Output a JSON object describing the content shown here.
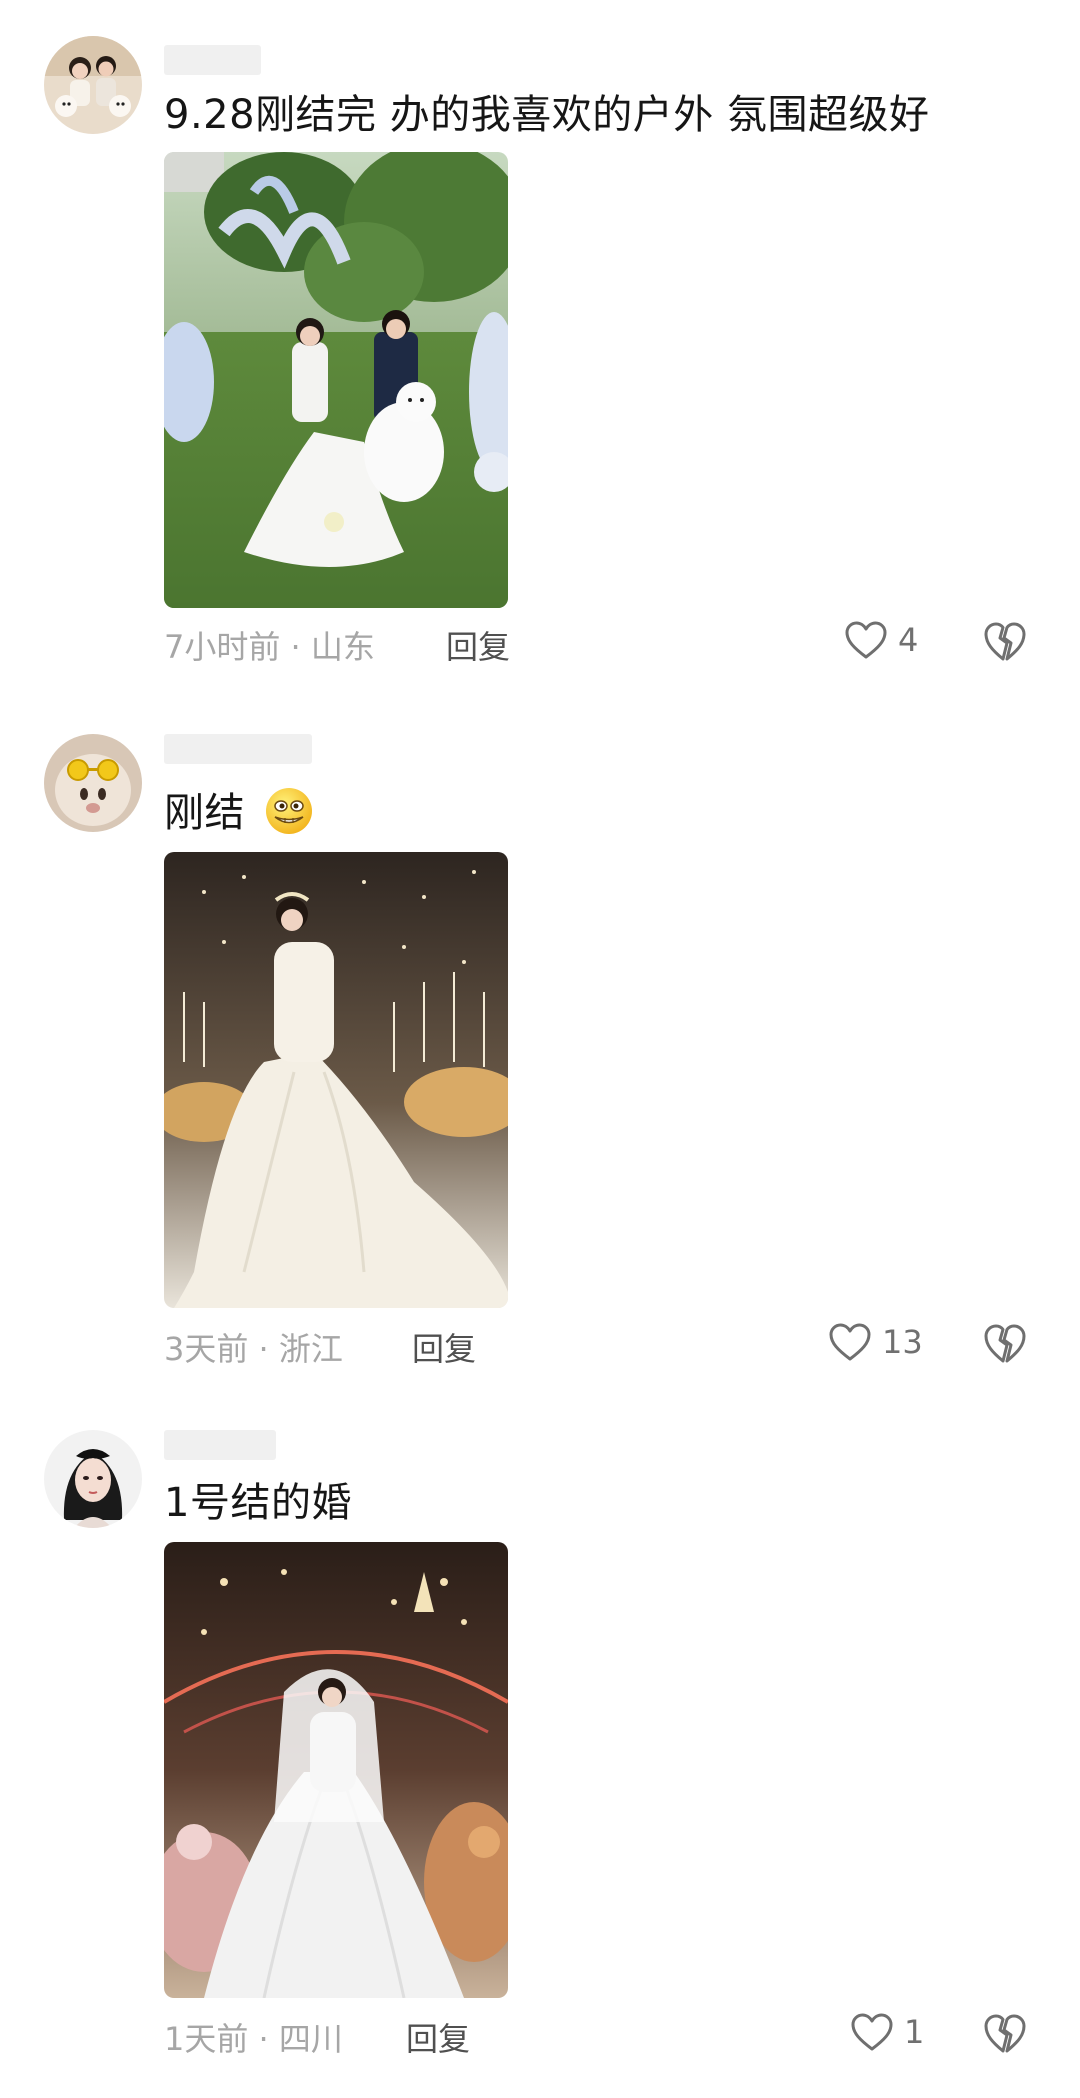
{
  "comments": [
    {
      "text": "9.28刚结完 办的我喜欢的户外 氛围超级好",
      "time": "7小时前",
      "separator": "·",
      "location": "山东",
      "reply_label": "回复",
      "likes": "4",
      "avatar_icon": "couple-with-dogs-avatar",
      "photo_subject": "outdoor-lawn-wedding-photo"
    },
    {
      "text": "刚结",
      "emoji_icon": "grinning-teeth-emoji-icon",
      "time": "3天前",
      "separator": "·",
      "location": "浙江",
      "reply_label": "回复",
      "likes": "13",
      "avatar_icon": "cat-with-sunglasses-avatar",
      "photo_subject": "bride-in-ballgown-photo"
    },
    {
      "text": "1号结的婚",
      "time": "1天前",
      "separator": "·",
      "location": "四川",
      "reply_label": "回复",
      "likes": "1",
      "avatar_icon": "anime-girl-avatar",
      "photo_subject": "bride-in-ballroom-photo"
    }
  ],
  "colors": {
    "text": "#161616",
    "meta": "#a6a6a6",
    "reply": "#505050",
    "icon": "#6f6f6f"
  }
}
